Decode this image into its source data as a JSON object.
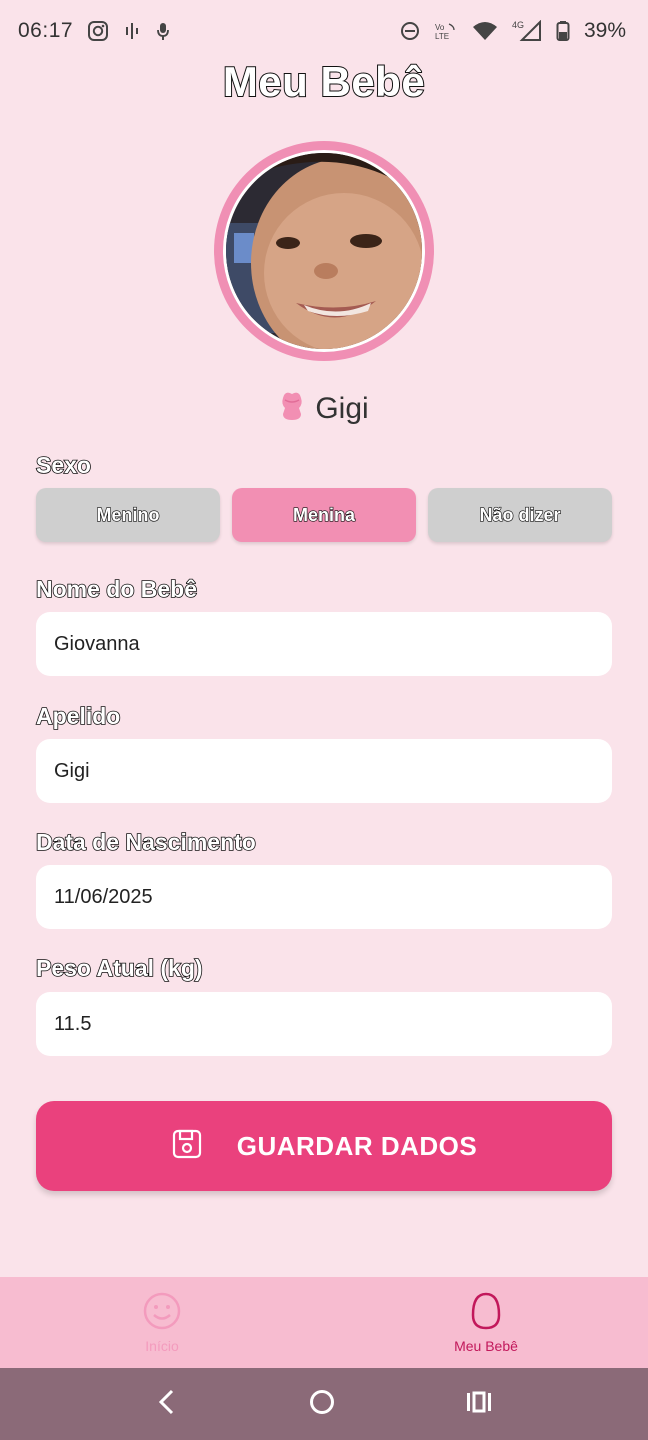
{
  "status_bar": {
    "time": "06:17",
    "battery_percent": "39%",
    "icons_left": [
      "instagram-icon",
      "voice-icon",
      "mic-icon"
    ],
    "icons_right": [
      "dnd-icon",
      "volte-icon",
      "wifi-icon",
      "signal-icon",
      "battery-icon"
    ],
    "network": "4G"
  },
  "page": {
    "title": "Meu Bebê"
  },
  "profile": {
    "nickname": "Gigi",
    "photo_icon": "baby-photo",
    "nickname_icon": "rose-icon"
  },
  "sex": {
    "label": "Sexo",
    "options": [
      "Menino",
      "Menina",
      "Não dizer"
    ],
    "selected": "Menina"
  },
  "fields": {
    "name": {
      "label": "Nome do Bebê",
      "value": "Giovanna"
    },
    "nickname": {
      "label": "Apelido",
      "value": "Gigi"
    },
    "birthdate": {
      "label": "Data de Nascimento",
      "value": "11/06/2025"
    },
    "weight": {
      "label": "Peso Atual (kg)",
      "value": "11.5"
    }
  },
  "actions": {
    "save_label": "GUARDAR DADOS",
    "save_icon": "floppy-save-icon"
  },
  "bottom_nav": {
    "items": [
      {
        "label": "Início",
        "icon": "smiley-icon",
        "active": false
      },
      {
        "label": "Meu Bebê",
        "icon": "egg-icon",
        "active": true
      }
    ]
  },
  "colors": {
    "background": "#fae3ea",
    "accent": "#ea417d",
    "selected_sex": "#f28fb3",
    "unselected_sex": "#cfcfcf",
    "avatar_ring": "#f08fb4",
    "bottom_nav_bg": "#f7bcd0",
    "nav_active": "#c2185b",
    "system_nav": "#8b6a78"
  }
}
